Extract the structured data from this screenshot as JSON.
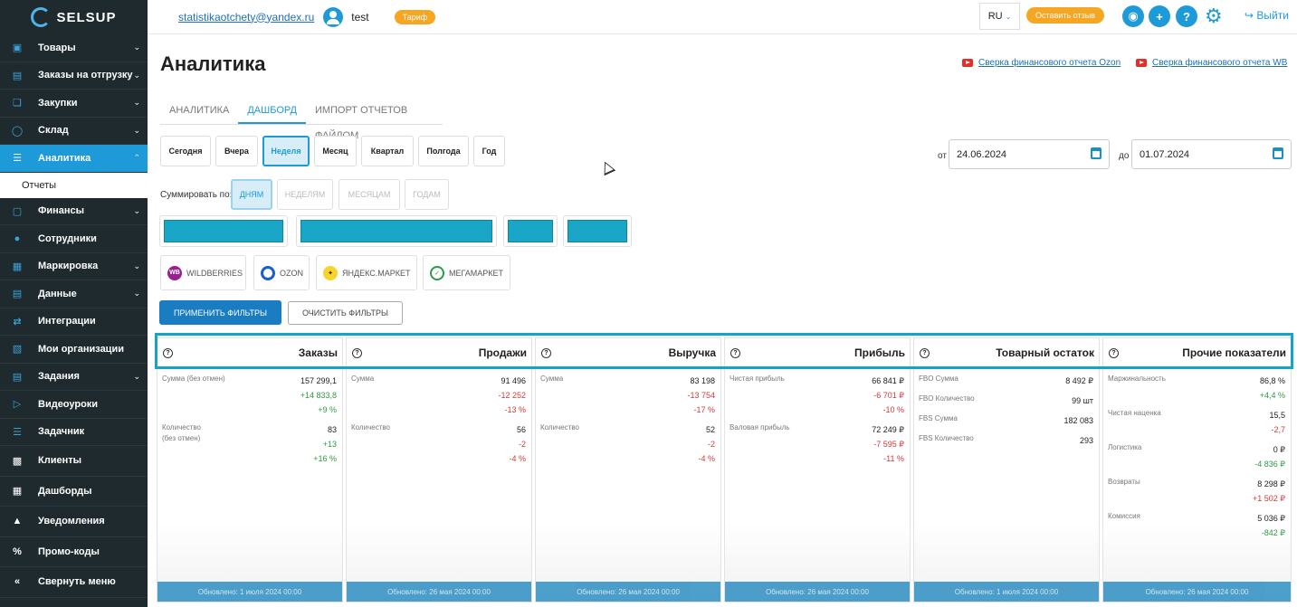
{
  "brand": "SELSUP",
  "sidebar": {
    "items": [
      {
        "label": "Товары",
        "icon": "box-icon",
        "chevron": true
      },
      {
        "label": "Заказы на отгрузку",
        "icon": "order-icon",
        "chevron": true
      },
      {
        "label": "Закупки",
        "icon": "cart-icon",
        "chevron": true
      },
      {
        "label": "Склад",
        "icon": "warehouse-icon",
        "chevron": true
      },
      {
        "label": "Аналитика",
        "icon": "chart-icon",
        "chevron": true,
        "active": true
      },
      {
        "label": "Отчеты",
        "sub": true
      },
      {
        "label": "Финансы",
        "icon": "wallet-icon",
        "chevron": true
      },
      {
        "label": "Сотрудники",
        "icon": "person-icon",
        "chevron": false
      },
      {
        "label": "Маркировка",
        "icon": "barcode-icon",
        "chevron": true
      },
      {
        "label": "Данные",
        "icon": "doc-icon",
        "chevron": true
      },
      {
        "label": "Интеграции",
        "icon": "integration-icon",
        "chevron": false
      },
      {
        "label": "Мои организации",
        "icon": "building-icon",
        "chevron": false
      },
      {
        "label": "Задания",
        "icon": "task-icon",
        "chevron": true
      },
      {
        "label": "Видеоуроки",
        "icon": "video-icon",
        "chevron": false
      },
      {
        "label": "Задачник",
        "icon": "list-icon",
        "chevron": false
      },
      {
        "label": "Клиенты",
        "icon": "lock-icon",
        "big": true
      },
      {
        "label": "Дашборды",
        "icon": "grid-icon",
        "big": true
      },
      {
        "label": "Уведомления",
        "icon": "bell-icon",
        "big": true
      },
      {
        "label": "Промо-коды",
        "icon": "percent-icon",
        "big": true
      },
      {
        "label": "Свернуть меню",
        "icon": "collapse-icon",
        "big": true
      }
    ]
  },
  "topbar": {
    "email": "statistikaotchety@yandex.ru",
    "username": "test",
    "tariff": "Тариф",
    "lang": "RU",
    "feedback": "Оставить отзыв",
    "logout": "Выйти"
  },
  "header": {
    "title": "Аналитика",
    "link_ozon": "Сверка финансового отчета Ozon",
    "link_wb": "Сверка финансового отчета WB"
  },
  "tabs": [
    "АНАЛИТИКА",
    "ДАШБОРД",
    "ИМПОРТ ОТЧЕТОВ ФАЙЛОМ"
  ],
  "periods": [
    "Сегодня",
    "Вчера",
    "Неделя",
    "Месяц",
    "Квартал",
    "Полгода",
    "Год"
  ],
  "dates": {
    "from_label": "от",
    "from": "24.06.2024",
    "to_label": "до",
    "to": "01.07.2024"
  },
  "summarize": {
    "label": "Суммировать по:",
    "options": [
      "ДНЯМ",
      "НЕДЕЛЯМ",
      "МЕСЯЦАМ",
      "ГОДАМ"
    ]
  },
  "marketplaces": [
    "WILDBERRIES",
    "OZON",
    "ЯНДЕКС.МАРКЕТ",
    "МЕГАМАРКЕТ"
  ],
  "buttons": {
    "apply": "ПРИМЕНИТЬ ФИЛЬТРЫ",
    "clear": "ОЧИСТИТЬ ФИЛЬТРЫ"
  },
  "cards": [
    {
      "title": "Заказы",
      "metrics": [
        {
          "label": "Сумма (без отмен)",
          "value": "157 299,1",
          "delta": "+14 833,8",
          "pct": "+9 %",
          "dir": "pos"
        },
        {
          "label": "Количество\n(без отмен)",
          "value": "83",
          "delta": "+13",
          "pct": "+16 %",
          "dir": "pos"
        }
      ],
      "updated": "Обновлено: 1 июля 2024 00:00"
    },
    {
      "title": "Продажи",
      "metrics": [
        {
          "label": "Сумма",
          "value": "91 496",
          "delta": "-12 252",
          "pct": "-13 %",
          "dir": "neg"
        },
        {
          "label": "Количество",
          "value": "56",
          "delta": "-2",
          "pct": "-4 %",
          "dir": "neg"
        }
      ],
      "updated": "Обновлено: 26 мая 2024 00:00"
    },
    {
      "title": "Выручка",
      "metrics": [
        {
          "label": "Сумма",
          "value": "83 198",
          "delta": "-13 754",
          "pct": "-17 %",
          "dir": "neg"
        },
        {
          "label": "Количество",
          "value": "52",
          "delta": "-2",
          "pct": "-4 %",
          "dir": "neg"
        }
      ],
      "updated": "Обновлено: 26 мая 2024 00:00"
    },
    {
      "title": "Прибыль",
      "metrics": [
        {
          "label": "Чистая прибыль",
          "value": "66 841 ₽",
          "delta": "-6 701 ₽",
          "pct": "-10 %",
          "dir": "neg"
        },
        {
          "label": "Валовая прибыль",
          "value": "72 249 ₽",
          "delta": "-7 595 ₽",
          "pct": "-11 %",
          "dir": "neg"
        }
      ],
      "updated": "Обновлено: 26 мая 2024 00:00"
    },
    {
      "title": "Товарный остаток",
      "metrics": [
        {
          "label": "FBO Сумма",
          "value": "8 492 ₽"
        },
        {
          "label": "FBO Количество",
          "value": "99 шт"
        },
        {
          "label": "FBS Сумма",
          "value": "182 083"
        },
        {
          "label": "FBS Количество",
          "value": "293"
        }
      ],
      "updated": "Обновлено: 1 июля 2024 00:00"
    },
    {
      "title": "Прочие показатели",
      "metrics": [
        {
          "label": "Маржинальность",
          "value": "86,8 %",
          "delta": "+4,4 %",
          "dir": "pos"
        },
        {
          "label": "Чистая наценка",
          "value": "15,5",
          "delta": "-2,7",
          "dir": "neg"
        },
        {
          "label": "Логистика",
          "value": "0 ₽",
          "delta": "-4 836 ₽",
          "dir": "pos"
        },
        {
          "label": "Возвраты",
          "value": "8 298 ₽",
          "delta": "+1 502 ₽",
          "dir": "neg"
        },
        {
          "label": "Комиссия",
          "value": "5 036 ₽",
          "delta": "-842 ₽",
          "dir": "pos"
        }
      ],
      "updated": "Обновлено: 26 мая 2024 00:00"
    }
  ],
  "colors": {
    "accent": "#1f9ad8",
    "sidebar": "#1f2a2e",
    "orange": "#f5a623",
    "highlight": "#12a5c9",
    "positive": "#2e9a46",
    "negative": "#d23a3a"
  }
}
